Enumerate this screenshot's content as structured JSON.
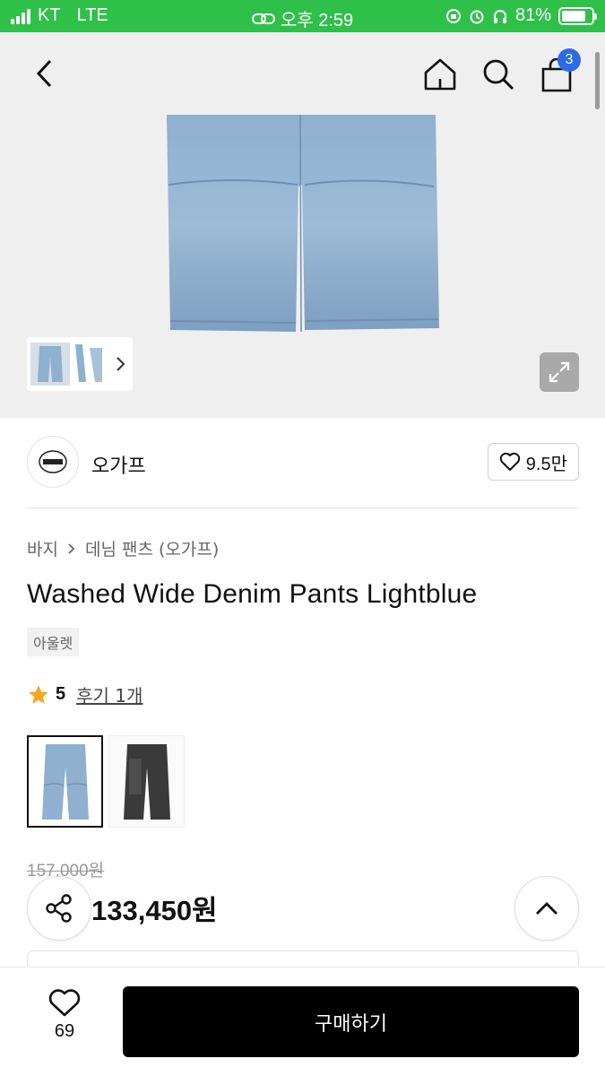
{
  "status_bar": {
    "carrier": "KT",
    "network": "LTE",
    "time": "오후 2:59",
    "battery": "81%",
    "battery_level": 0.81
  },
  "header": {
    "icons": [
      "back-icon",
      "home-icon",
      "search-icon",
      "cart-icon"
    ],
    "cart_count": "3"
  },
  "brand": {
    "name": "오가프",
    "likes": "9.5만"
  },
  "breadcrumb": {
    "category": "바지",
    "sub": "데님 팬츠 (오가프)"
  },
  "product": {
    "title": "Washed Wide Denim Pants Lightblue",
    "tag": "아울렛",
    "rating": "5",
    "reviews": "후기 1개",
    "original_price": "157,000원",
    "sale_price": "133,450원"
  },
  "variants": [
    {
      "color": "lightblue",
      "selected": true
    },
    {
      "color": "black",
      "selected": false
    }
  ],
  "bottom": {
    "wish_count": "69",
    "buy_label": "구매하기"
  },
  "colors": {
    "status_green": "#2fc04a",
    "badge_blue": "#2d6be4",
    "star": "#f5a623"
  }
}
